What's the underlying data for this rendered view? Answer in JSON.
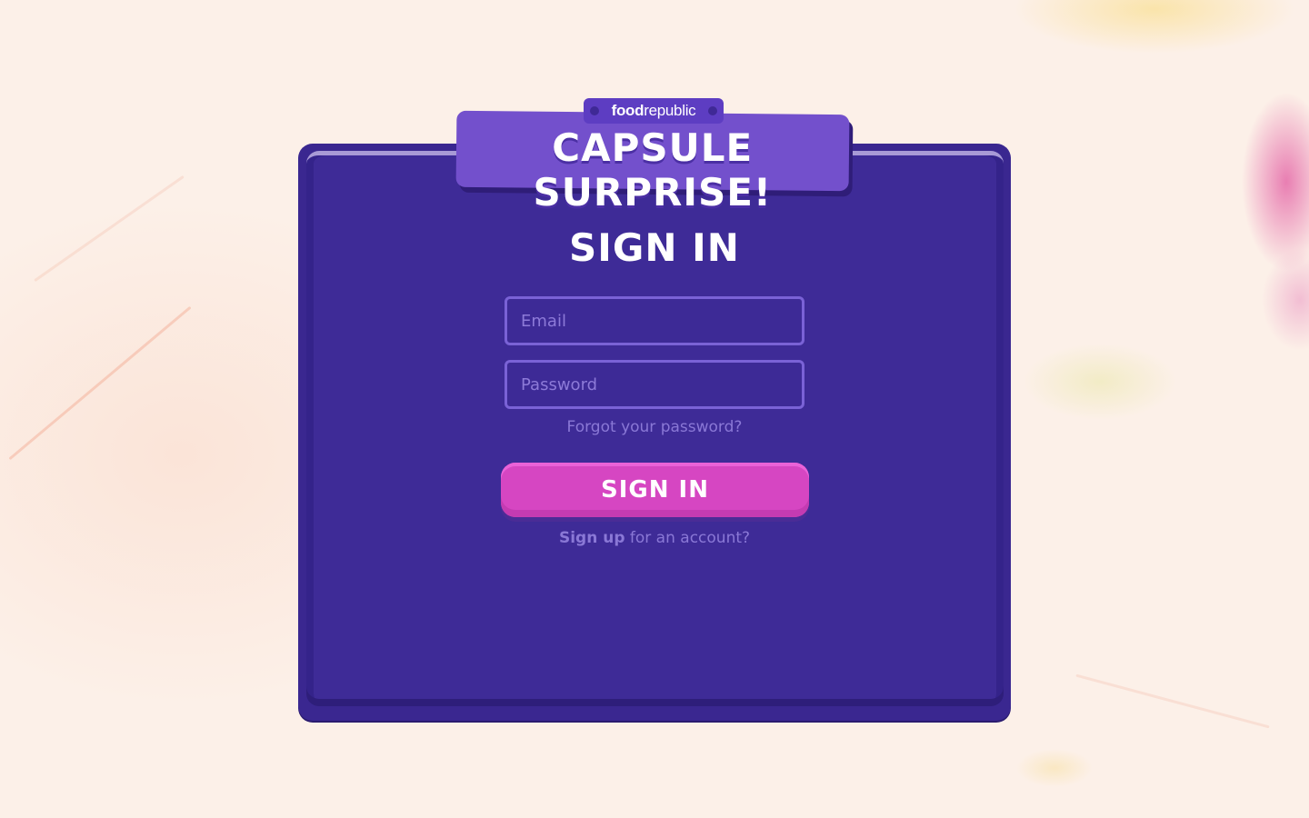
{
  "brand": {
    "name_bold": "food",
    "name_regular": "republic"
  },
  "banner": {
    "title": "CAPSULE SURPRISE!"
  },
  "form": {
    "heading": "SIGN IN",
    "email_placeholder": "Email",
    "password_placeholder": "Password",
    "forgot_label": "Forgot your password?",
    "submit_label": "SIGN IN",
    "signup_link": "Sign up",
    "signup_suffix": " for an account?"
  },
  "colors": {
    "panel": "#3e2b97",
    "banner": "#7350cc",
    "button": "#d646c2",
    "link_text": "#8a78d6",
    "background": "#fcf0e8"
  }
}
